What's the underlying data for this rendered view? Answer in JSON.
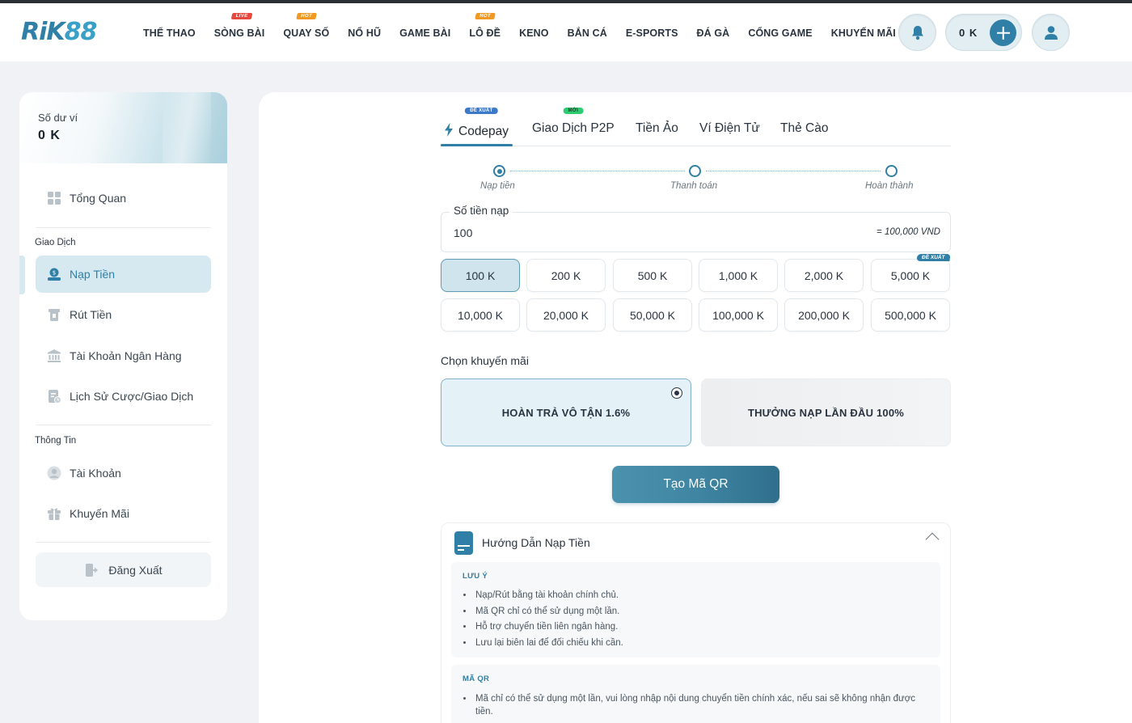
{
  "header": {
    "logo": {
      "part1": "RiK",
      "part2": "88"
    },
    "nav": [
      {
        "label": "THỂ THAO",
        "badge": ""
      },
      {
        "label": "SÒNG BÀI",
        "badge": "LIVE"
      },
      {
        "label": "QUAY SỐ",
        "badge": "HOT"
      },
      {
        "label": "NỔ HŨ",
        "badge": ""
      },
      {
        "label": "GAME BÀI",
        "badge": ""
      },
      {
        "label": "LÔ ĐỀ",
        "badge": "HOT"
      },
      {
        "label": "KENO",
        "badge": ""
      },
      {
        "label": "BẮN CÁ",
        "badge": ""
      },
      {
        "label": "E-SPORTS",
        "badge": ""
      },
      {
        "label": "ĐÁ GÀ",
        "badge": ""
      },
      {
        "label": "CỔNG GAME",
        "badge": ""
      },
      {
        "label": "KHUYẾN MÃI",
        "badge": ""
      }
    ],
    "wallet_amount": "0 K",
    "icons": {
      "bell": "bell-icon",
      "plus": "plus-icon",
      "user": "user-icon"
    }
  },
  "sidebar": {
    "wallet_label": "Số dư ví",
    "wallet_value": "0 K",
    "overview": "Tổng Quan",
    "section_transactions": "Giao Dịch",
    "items_transactions": [
      "Nạp Tiền",
      "Rút Tiền",
      "Tài Khoản Ngân Hàng",
      "Lịch Sử Cược/Giao Dịch"
    ],
    "section_info": "Thông Tin",
    "items_info": [
      "Tài Khoản",
      "Khuyến Mãi"
    ],
    "logout": "Đăng Xuất",
    "active_item": "Nạp Tiền"
  },
  "deposit": {
    "tabs": [
      {
        "label": "Codepay",
        "badge": "ĐỀ XUẤT"
      },
      {
        "label": "Giao Dịch P2P",
        "badge": "MỚI"
      },
      {
        "label": "Tiền Ảo",
        "badge": ""
      },
      {
        "label": "Ví Điện Tử",
        "badge": ""
      },
      {
        "label": "Thẻ Cào",
        "badge": ""
      }
    ],
    "active_tab": "Codepay",
    "steps": [
      "Nạp tiền",
      "Thanh toán",
      "Hoàn thành"
    ],
    "active_step": 0,
    "amount_label": "Số tiền nạp",
    "amount_value": "100",
    "amount_converted": "= 100,000 VND",
    "chips": [
      "100 K",
      "200 K",
      "500 K",
      "1,000 K",
      "2,000 K",
      "5,000 K",
      "10,000 K",
      "20,000 K",
      "50,000 K",
      "100,000 K",
      "200,000 K",
      "500,000 K"
    ],
    "selected_chip": "100 K",
    "recommended_chip": "5,000 K",
    "recommended_badge": "ĐỀ XUẤT",
    "promo_title": "Chọn khuyến mãi",
    "promos": [
      "HOÀN TRẢ VÔ TẬN 1.6%",
      "THƯỞNG NẠP LẦN ĐẦU 100%"
    ],
    "selected_promo": "HOÀN TRẢ VÔ TẬN 1.6%",
    "submit": "Tạo Mã QR"
  },
  "guide": {
    "title": "Hướng Dẫn Nạp Tiền",
    "note_title": "LƯU Ý",
    "notes": [
      "Nạp/Rút bằng tài khoản chính chủ.",
      "Mã QR chỉ có thể sử dụng một lần.",
      "Hỗ trợ chuyển tiền liên ngân hàng.",
      "Lưu lại biên lai để đối chiếu khi cần."
    ],
    "qr_title": "MÃ QR",
    "qr_notes": [
      "Mã chỉ có thể sử dụng một lần, vui lòng nhập nội dung chuyển tiền chính xác, nếu sai sẽ không nhận được tiền."
    ]
  },
  "colors": {
    "accent": "#2f7fa6",
    "badge_live": "#e6483d",
    "badge_hot": "#f09a24",
    "badge_new": "#2ecc71"
  }
}
